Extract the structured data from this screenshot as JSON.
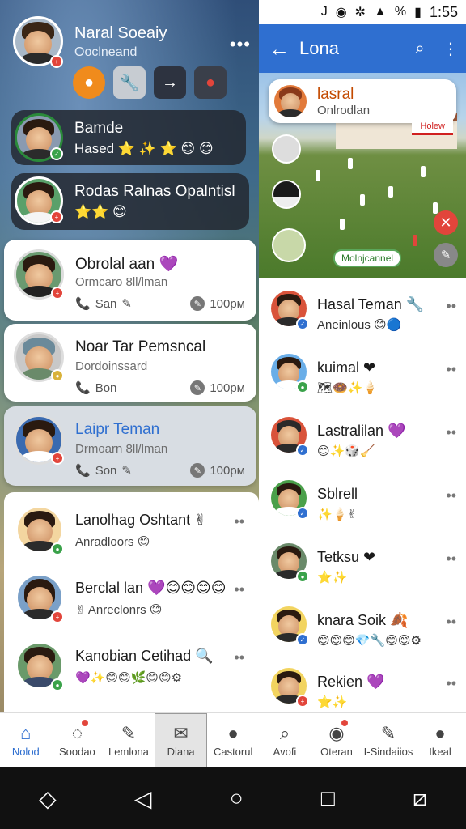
{
  "status_bar": {
    "time": "1:55",
    "icons": [
      "j",
      "o",
      "gear",
      "wifi",
      "%",
      "battery"
    ]
  },
  "left_header": {
    "name": "Naral Soeaiy",
    "subtitle": "Ooclneand",
    "more": "•••",
    "actions": [
      "person-add-icon",
      "wrench-icon",
      "arrow-right-icon",
      "avatar-icon"
    ]
  },
  "chips": [
    {
      "title": "Bamde",
      "sub": "Hased ⭐ ✨ ⭐ 😊 😊",
      "lead": "😊"
    },
    {
      "title": "Rodas Ralnas Opalntisl",
      "sub": "⭐⭐ 😊"
    }
  ],
  "cards": [
    {
      "name": "Obrolal aan 💜",
      "sub": "Ormcaro 8ll/lman",
      "meta": "San",
      "time": "100рм"
    },
    {
      "name": "Noar Tar Pemsncal",
      "sub": "Dordoinssard",
      "meta": "Bon",
      "time": "100рм"
    },
    {
      "name": "Laipr Teman",
      "sub": "Drmoarn 8ll/lman",
      "meta": "Son",
      "time": "100рм"
    }
  ],
  "left_list": [
    {
      "name": "Lanolhag Oshtant ✌",
      "sub": "Anradloors 😊"
    },
    {
      "name": "Berclal lan 💜😊😊😊😊",
      "sub": "✌ Anreclonrs 😊"
    },
    {
      "name": "Kanobian Cetihad 🔍",
      "sub": "💜✨😊😊🌿😊😊⚙"
    }
  ],
  "right_header": {
    "title": "Lona",
    "back": "←",
    "search": "search-icon",
    "more": "⋮"
  },
  "field": {
    "card_name": "lasral",
    "card_sub": "Onlrodlan",
    "tag": "Holew",
    "label": "Molnjcannel"
  },
  "right_list": [
    {
      "name": "Hasal Teman 🔧",
      "sub": "Aneinlous 😊🔵"
    },
    {
      "name": "kuimal ❤",
      "sub": "🗺🍩✨🍦"
    },
    {
      "name": "Lastralilan 💜",
      "sub": "😊✨🎲🧹"
    },
    {
      "name": "Sblrell",
      "sub": "✨🍦✌"
    },
    {
      "name": "Tetksu ❤",
      "sub": "⭐✨"
    },
    {
      "name": "knara Soik 🍂",
      "sub": "😊😊😊💎🔧😊😊⚙"
    },
    {
      "name": "Rekien 💜",
      "sub": "⭐✨"
    }
  ],
  "nav_left": [
    {
      "label": "Nolod",
      "icon": "home-icon",
      "active": true
    },
    {
      "label": "Soodao",
      "icon": "chat-icon"
    },
    {
      "label": "Lemlona",
      "icon": "edit-icon"
    },
    {
      "label": "Diana",
      "icon": "mail-icon",
      "boxed": true
    },
    {
      "label": "Castorul",
      "icon": "person-icon"
    }
  ],
  "nav_right": [
    {
      "label": "Avofi",
      "icon": "search-icon"
    },
    {
      "label": "Oteran",
      "icon": "disc-icon"
    },
    {
      "label": "I-Sindaiios",
      "icon": "edit-icon"
    },
    {
      "label": "Ikeal",
      "icon": "person-icon"
    }
  ],
  "colors": {
    "accent": "#2f6fd0",
    "danger": "#e2453b",
    "panel_dark": "#23282f"
  }
}
